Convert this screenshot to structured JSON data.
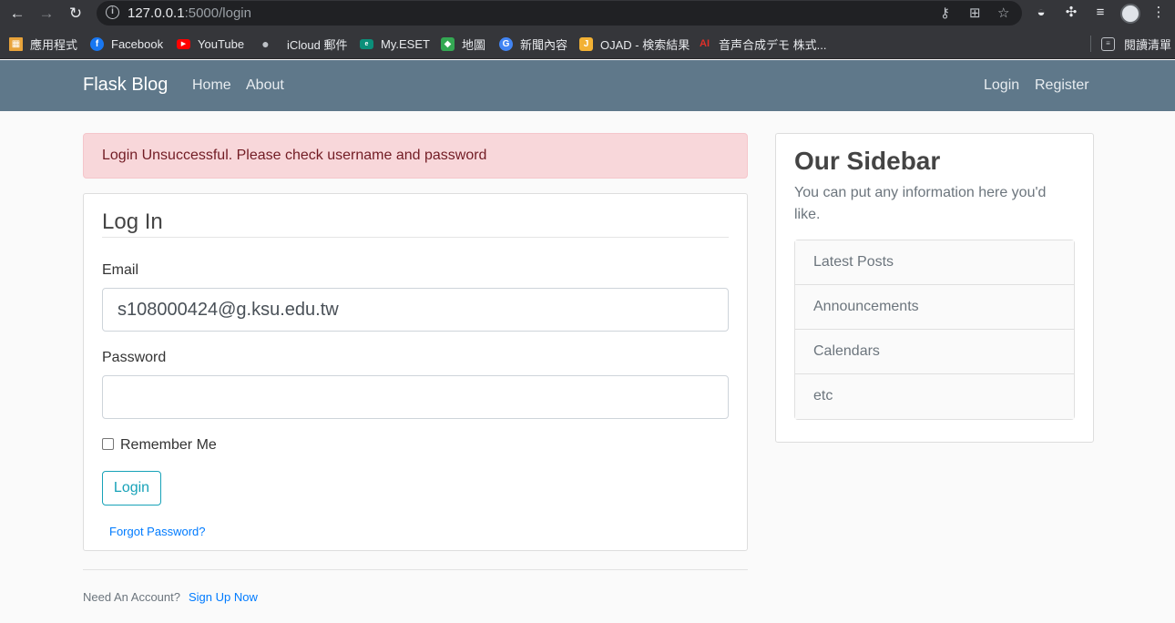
{
  "browser": {
    "url_host": "127.0.0.1",
    "url_rest": ":5000/login",
    "bookmarks": [
      "應用程式",
      "Facebook",
      "YouTube",
      "iCloud 郵件",
      "My.ESET",
      "地圖",
      "新聞內容",
      "OJAD - 検索結果",
      "音声合成デモ 株式...",
      "閱讀清單"
    ]
  },
  "navbar": {
    "brand": "Flask Blog",
    "home": "Home",
    "about": "About",
    "login": "Login",
    "register": "Register"
  },
  "alert": {
    "message": "Login Unsuccessful. Please check username and password"
  },
  "form": {
    "legend": "Log In",
    "email_label": "Email",
    "email_value": "s108000424@g.ksu.edu.tw",
    "password_label": "Password",
    "password_value": "",
    "remember_label": "Remember Me",
    "submit": "Login",
    "forgot": "Forgot Password?"
  },
  "footer": {
    "text": "Need An Account?",
    "link": "Sign Up Now"
  },
  "sidebar": {
    "title": "Our Sidebar",
    "text": "You can put any information here you'd like.",
    "items": [
      "Latest Posts",
      "Announcements",
      "Calendars",
      "etc"
    ]
  }
}
